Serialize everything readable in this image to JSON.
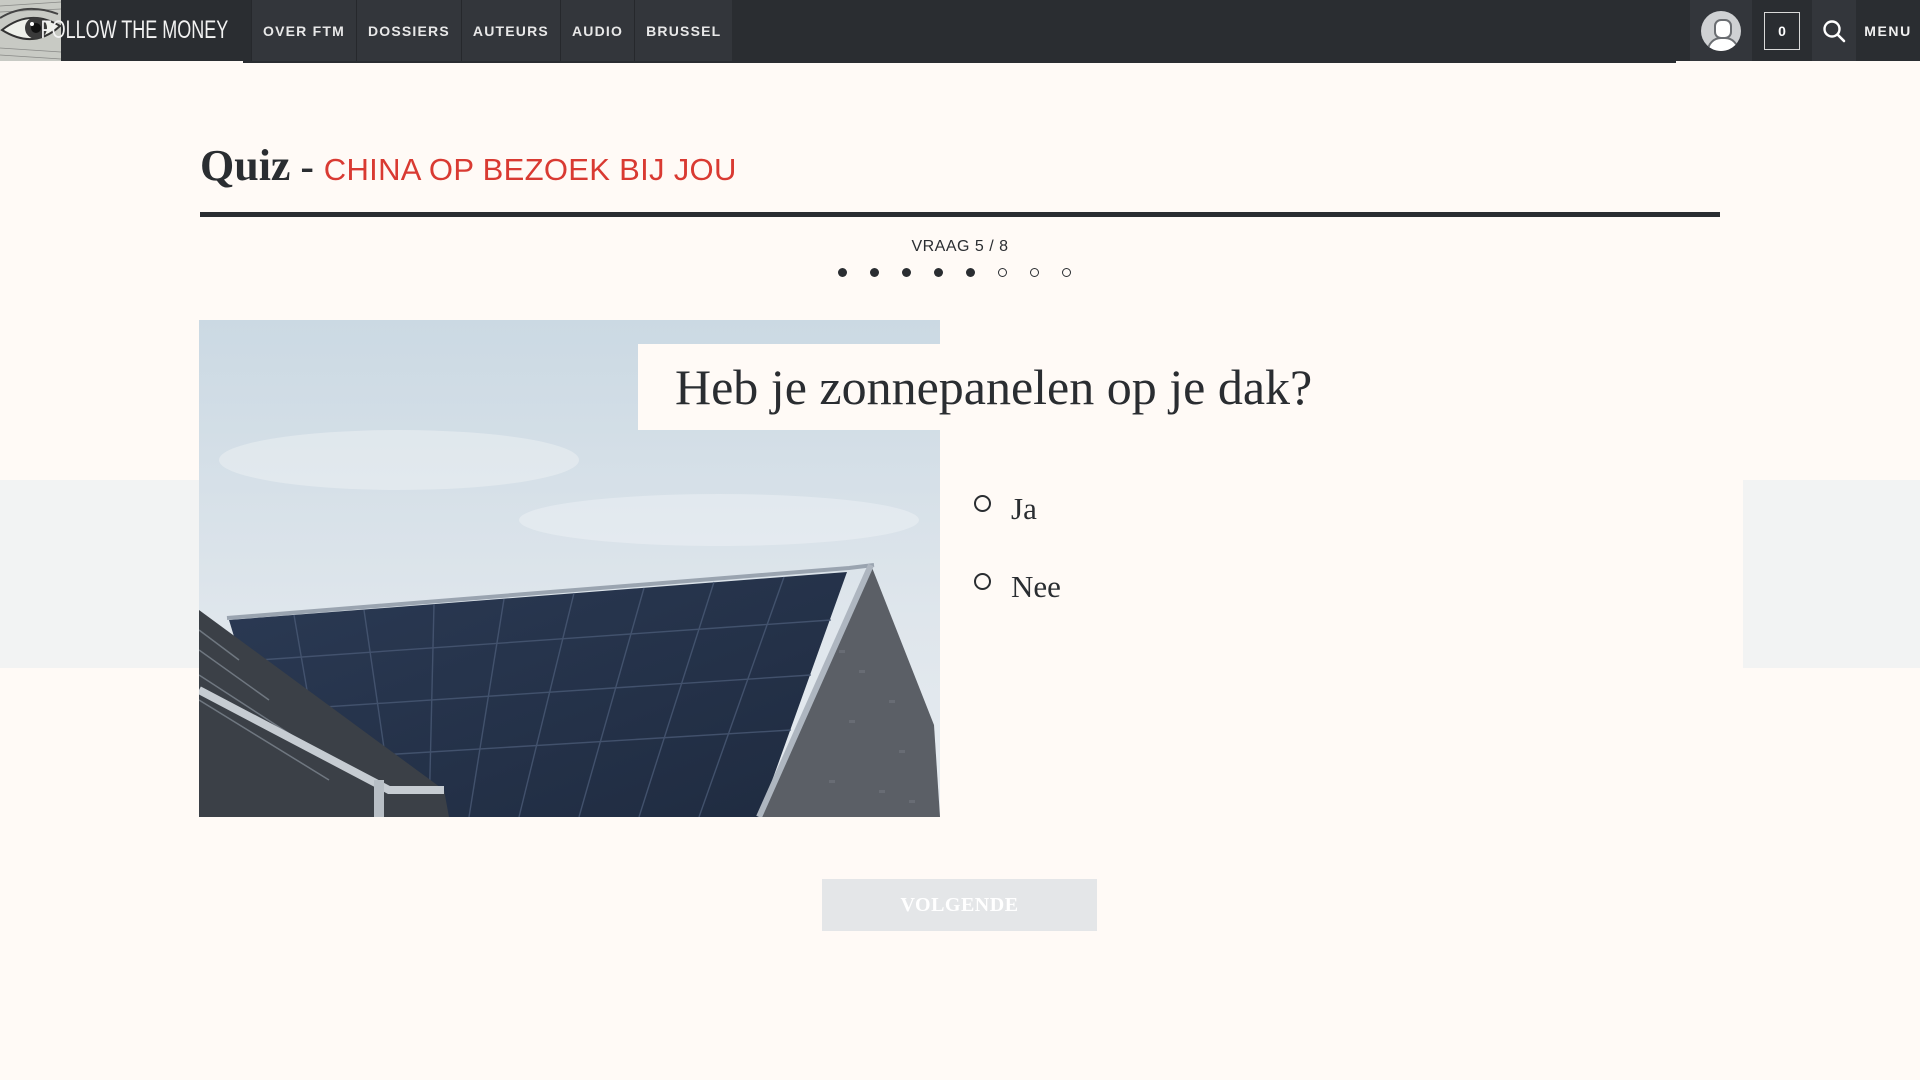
{
  "header": {
    "logo_text": "FOLLOW THE MONEY",
    "nav": [
      "OVER FTM",
      "DOSSIERS",
      "AUTEURS",
      "AUDIO",
      "BRUSSEL"
    ],
    "cart_count": "0",
    "menu_label": "MENU",
    "icons": {
      "avatar": "user-avatar-icon",
      "search": "search-icon",
      "logo": "eye-logo-icon"
    }
  },
  "quiz": {
    "label": "Quiz",
    "separator": "-",
    "name": "CHINA OP BEZOEK BIJ JOU",
    "progress_text": "VRAAG 5 / 8",
    "progress": {
      "current": 5,
      "total": 8
    },
    "question": "Heb je zonnepanelen op je dak?",
    "answers": [
      "Ja",
      "Nee"
    ],
    "next_label": "VOLGENDE"
  },
  "colors": {
    "background": "#fffaf6",
    "topbar": "#2a2d31",
    "accent_red": "#d93a32",
    "button_disabled": "#e4e6e8"
  }
}
